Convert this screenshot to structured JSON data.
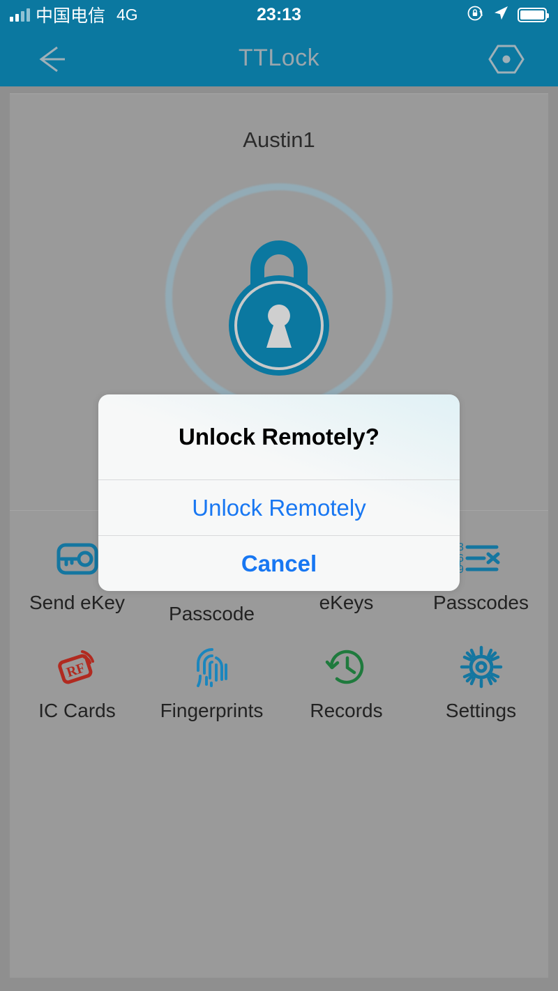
{
  "status_bar": {
    "carrier": "中国电信",
    "network": "4G",
    "time": "23:13",
    "signal_bars": 4,
    "icons": [
      "signal-bars-icon",
      "rotation-lock-icon",
      "location-arrow-icon",
      "battery-icon"
    ]
  },
  "nav_bar": {
    "title": "TTLock",
    "back_icon": "back-arrow-icon",
    "right_icon": "hexagon-dot-icon",
    "background_color": "#0b78a0",
    "title_color": "#9aa6ad"
  },
  "main": {
    "device_name": "Austin1",
    "lock_icon": "padlock-icon",
    "lock_color": "#0b78a0",
    "fab_icon": "wifi-waves-icon",
    "fab_color": "#0b78a0"
  },
  "grid": {
    "items": [
      {
        "label": "Send eKey",
        "icon": "key-card-icon",
        "color": "#1476a0"
      },
      {
        "label": "Passcode",
        "icon": "passcode-icon",
        "color": "#1476a0"
      },
      {
        "label": "eKeys",
        "icon": "ekeys-icon",
        "color": "#1476a0"
      },
      {
        "label": "Passcodes",
        "icon": "passcodes-list-icon",
        "color": "#1476a0"
      },
      {
        "label": "IC Cards",
        "icon": "rf-card-icon",
        "color": "#b12a20"
      },
      {
        "label": "Fingerprints",
        "icon": "fingerprint-icon",
        "color": "#1b86bd"
      },
      {
        "label": "Records",
        "icon": "history-clock-icon",
        "color": "#1f7a3d"
      },
      {
        "label": "Settings",
        "icon": "gear-icon",
        "color": "#1476a0"
      }
    ]
  },
  "dialog": {
    "title": "Unlock Remotely?",
    "primary_action": "Unlock Remotely",
    "cancel_action": "Cancel",
    "accent_color": "#1877f2"
  }
}
